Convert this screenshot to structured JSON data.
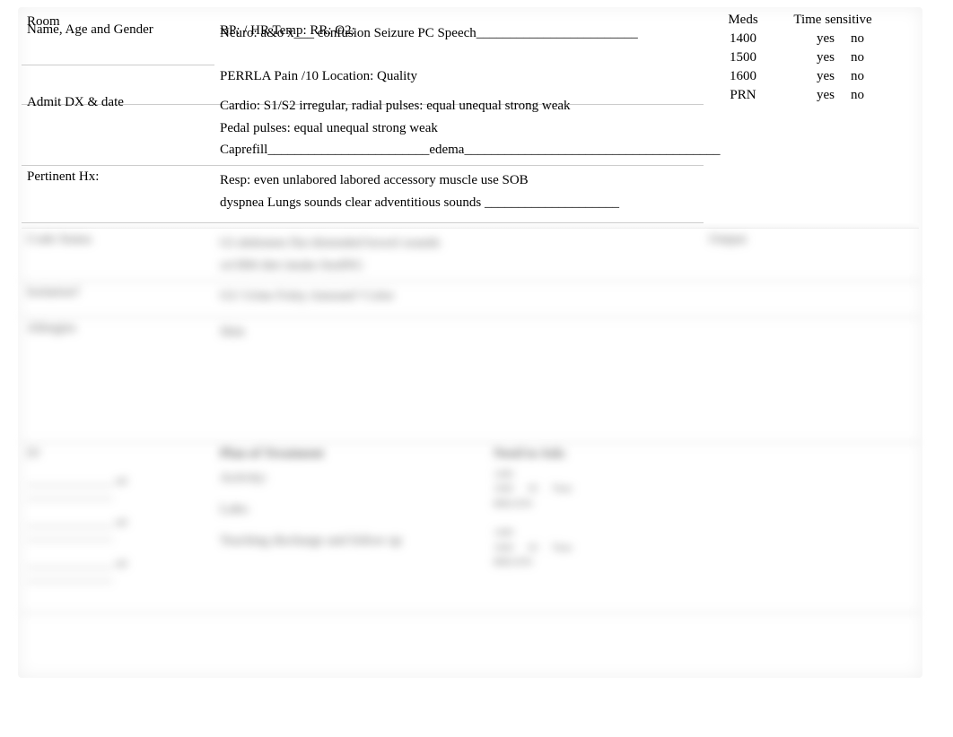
{
  "left": {
    "room": "Room",
    "name": "Name, Age and Gender",
    "admit": "Admit DX & date",
    "hx": "Pertinent Hx:",
    "codeStatus": "Code Status",
    "isolation": "Isolation?",
    "allergies": "Allergies",
    "iv": "IV"
  },
  "mid": {
    "vitals": "BP:        /          HR           Temp:               RR:                 O2:",
    "neuro": "Neuro: a&o x___    confusion    Seizure PC  Speech________________________",
    "perrla": "  PERRLA  Pain      /10   Location:                      Quality",
    "cardio": "Cardio:   S1/S2    irregular, radial pulses:     equal    unequal     strong    weak",
    "pedal": "Pedal pulses:     equal    unequal     strong     weak",
    "caprefill": "Caprefill________________________edema______________________________________",
    "resp": "Resp:     even    unlabored     labored     accessory muscle use       SOB",
    "dyspnea": "   dyspnea     Lungs sounds clear    adventitious sounds ____________________",
    "gi_blur1": "GI   abdomen   flat    distended    bowel sounds",
    "gi_blur2": "  x4    BM    diet    intake    feedNG",
    "gu_blur": "GU Urine Foley         Amount?             Color",
    "skin_blur": "Skin",
    "plan_header": "Plan of Treatment",
    "activity": "Activity:",
    "labs": "Labs:",
    "teaching": "Teaching discharge and follow up",
    "to_ask": "Need to Ask:"
  },
  "meds": {
    "header1": "Meds",
    "header2": "Time sensitive",
    "rows": [
      {
        "time": "1400",
        "yes": "yes",
        "no": "no"
      },
      {
        "time": "1500",
        "yes": "yes",
        "no": "no"
      },
      {
        "time": "1600",
        "yes": "yes",
        "no": "no"
      },
      {
        "time": "PRN",
        "yes": "yes",
        "no": "no"
      }
    ],
    "output_blur": "Output"
  },
  "ivlines": {
    "ml1": "________________ ml ________________",
    "ml2": "________________ ml ________________",
    "ml3": "________________ ml ________________"
  },
  "askbox": {
    "r1a": "1400",
    "r1b": "1600",
    "r1c": "0C",
    "r1d": "Time",
    "r1e": "BREATH",
    "r2a": "1400",
    "r2b": "1600",
    "r2c": "0C",
    "r2d": "Time",
    "r2e": "BREATH"
  }
}
